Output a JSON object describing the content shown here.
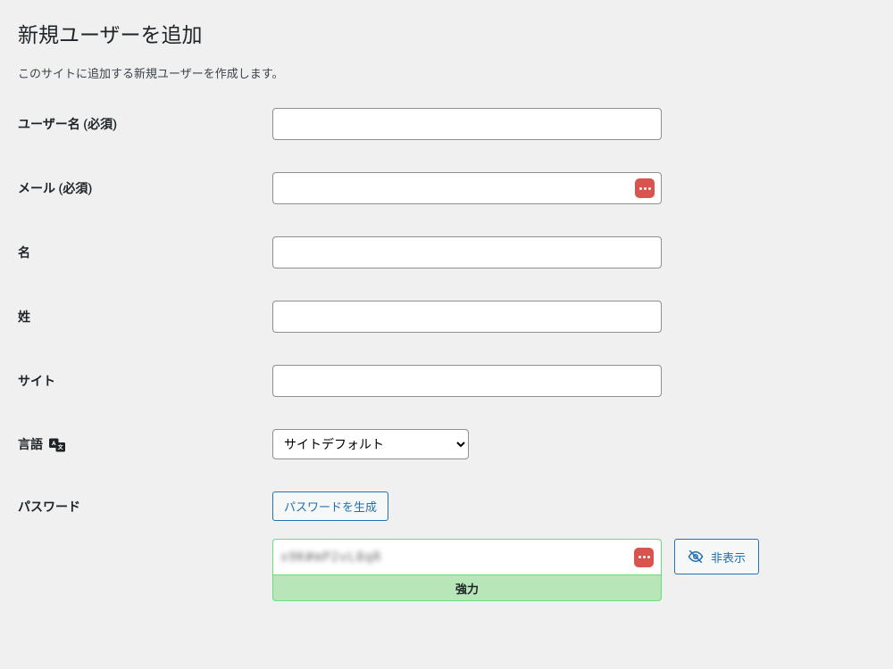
{
  "page": {
    "title": "新規ユーザーを追加",
    "description": "このサイトに追加する新規ユーザーを作成します。"
  },
  "fields": {
    "username": {
      "label": "ユーザー名 (必須)",
      "value": ""
    },
    "email": {
      "label": "メール (必須)",
      "value": ""
    },
    "firstname": {
      "label": "名",
      "value": ""
    },
    "lastname": {
      "label": "姓",
      "value": ""
    },
    "website": {
      "label": "サイト",
      "value": ""
    },
    "language": {
      "label": "言語",
      "selected": "サイトデフォルト"
    },
    "password": {
      "label": "パスワード",
      "generate_button": "パスワードを生成",
      "hide_button": "非表示",
      "strength": "強力",
      "masked_value": "x9K#mP2vL8qR"
    }
  },
  "colors": {
    "accent": "#2271b1",
    "strength_bg": "#b8e6b8",
    "strength_border": "#68de7c",
    "badge": "#d9534f"
  }
}
